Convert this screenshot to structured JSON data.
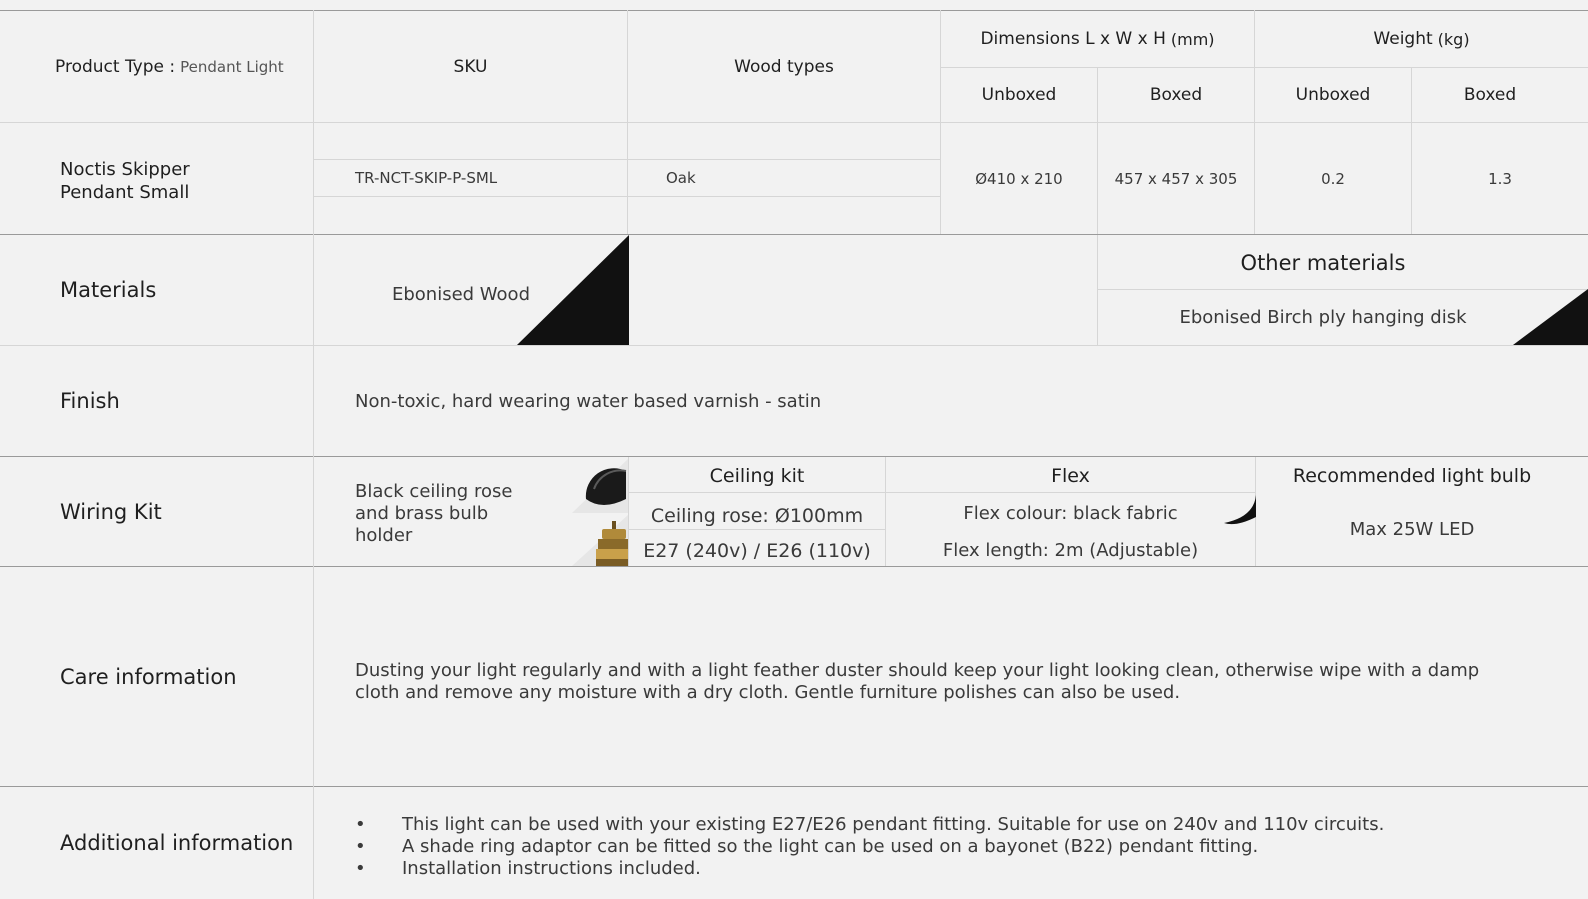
{
  "header": {
    "product_type_label": "Product Type :",
    "product_type_value": "Pendant Light",
    "sku": "SKU",
    "wood_types": "Wood types",
    "dimensions": "Dimensions L x W x H",
    "dimensions_unit": "(mm)",
    "weight": "Weight",
    "weight_unit": "(kg)",
    "unboxed": "Unboxed",
    "boxed": "Boxed"
  },
  "product": {
    "name_line1": "Noctis Skipper",
    "name_line2": "Pendant Small",
    "sku": "TR-NCT-SKIP-P-SML",
    "wood": "Oak",
    "dim_unboxed": "Ø410 x 210",
    "dim_boxed": "457 x 457 x 305",
    "weight_unboxed": "0.2",
    "weight_boxed": "1.3"
  },
  "materials": {
    "label": "Materials",
    "main": "Ebonised Wood",
    "other_title": "Other materials",
    "other_value": "Ebonised Birch ply hanging disk"
  },
  "finish": {
    "label": "Finish",
    "value": "Non-toxic, hard wearing water based varnish - satin"
  },
  "wiring": {
    "label": "Wiring Kit",
    "description_lines": [
      "Black ceiling rose",
      "and brass bulb",
      "holder"
    ],
    "ceiling_kit_title": "Ceiling kit",
    "ceiling_rose": "Ceiling rose: Ø100mm",
    "bulb_fitting": "E27 (240v) / E26 (110v)",
    "flex_title": "Flex",
    "flex_colour": "Flex colour: black fabric",
    "flex_length": "Flex length: 2m (Adjustable)",
    "bulb_title": "Recommended light bulb",
    "bulb_value": "Max 25W LED"
  },
  "care": {
    "label": "Care information",
    "line1": "Dusting your light regularly and with a light feather duster should keep your light looking clean, otherwise wipe with a damp",
    "line2": "cloth and remove any moisture with a dry cloth. Gentle furniture polishes can also be used."
  },
  "additional": {
    "label": "Additional information",
    "items": [
      "This light can be used with your existing E27/E26 pendant fitting. Suitable for use on 240v and 110v circuits.",
      "A shade ring adaptor can be fitted so the light can be used on a bayonet (B22) pendant fitting.",
      "Installation instructions included."
    ]
  },
  "colors": {
    "background": "#f2f2f2",
    "line": "#d6d6d6",
    "line_dark": "#9a9a9a",
    "swatch": "#111111",
    "brass": "#b08a3a"
  }
}
